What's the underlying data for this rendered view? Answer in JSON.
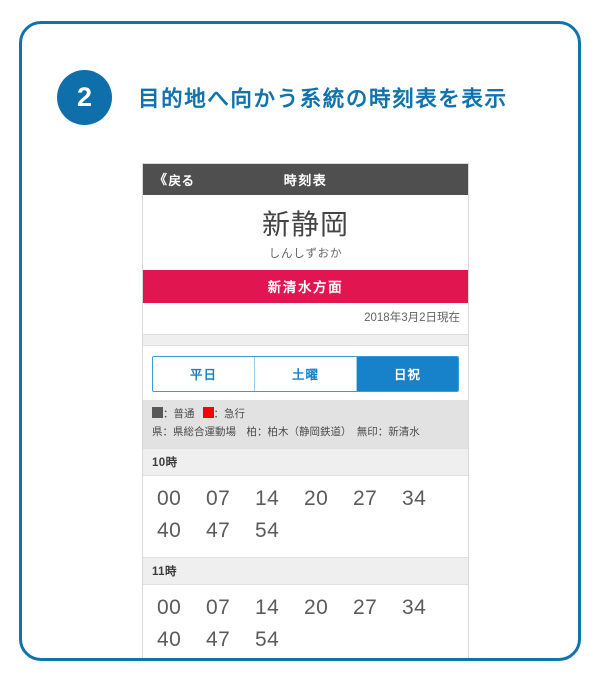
{
  "step": {
    "number": "2",
    "title": "目的地へ向かう系統の時刻表を表示"
  },
  "screenshot": {
    "navbar": {
      "back_chevron": "《",
      "back_label": "戻る",
      "title": "時刻表"
    },
    "station": {
      "name": "新静岡",
      "kana": "しんしずおか"
    },
    "direction_label": "新清水方面",
    "as_of": "2018年3月2日現在",
    "tabs": [
      {
        "label": "平日",
        "active": false
      },
      {
        "label": "土曜",
        "active": false
      },
      {
        "label": "日祝",
        "active": true
      }
    ],
    "legend": {
      "line1_local": "：普通",
      "line1_express": "：急行",
      "line2": "県：県総合運動場　柏：柏木（静岡鉄道）　無印：新清水",
      "color_local": "#585858",
      "color_express": "#fb0000"
    },
    "timetable": [
      {
        "hour_label": "10時",
        "rows": [
          [
            "00",
            "07",
            "14",
            "20",
            "27",
            "34"
          ],
          [
            "40",
            "47",
            "54"
          ]
        ]
      },
      {
        "hour_label": "11時",
        "rows": [
          [
            "00",
            "07",
            "14",
            "20",
            "27",
            "34"
          ],
          [
            "40",
            "47",
            "54"
          ]
        ]
      }
    ]
  },
  "colors": {
    "frame_blue": "#1073ad",
    "badge_blue": "#0f6fab",
    "tab_blue": "#1781c9",
    "direction_red": "#e1154f",
    "navbar_gray": "#4f4f4f"
  }
}
